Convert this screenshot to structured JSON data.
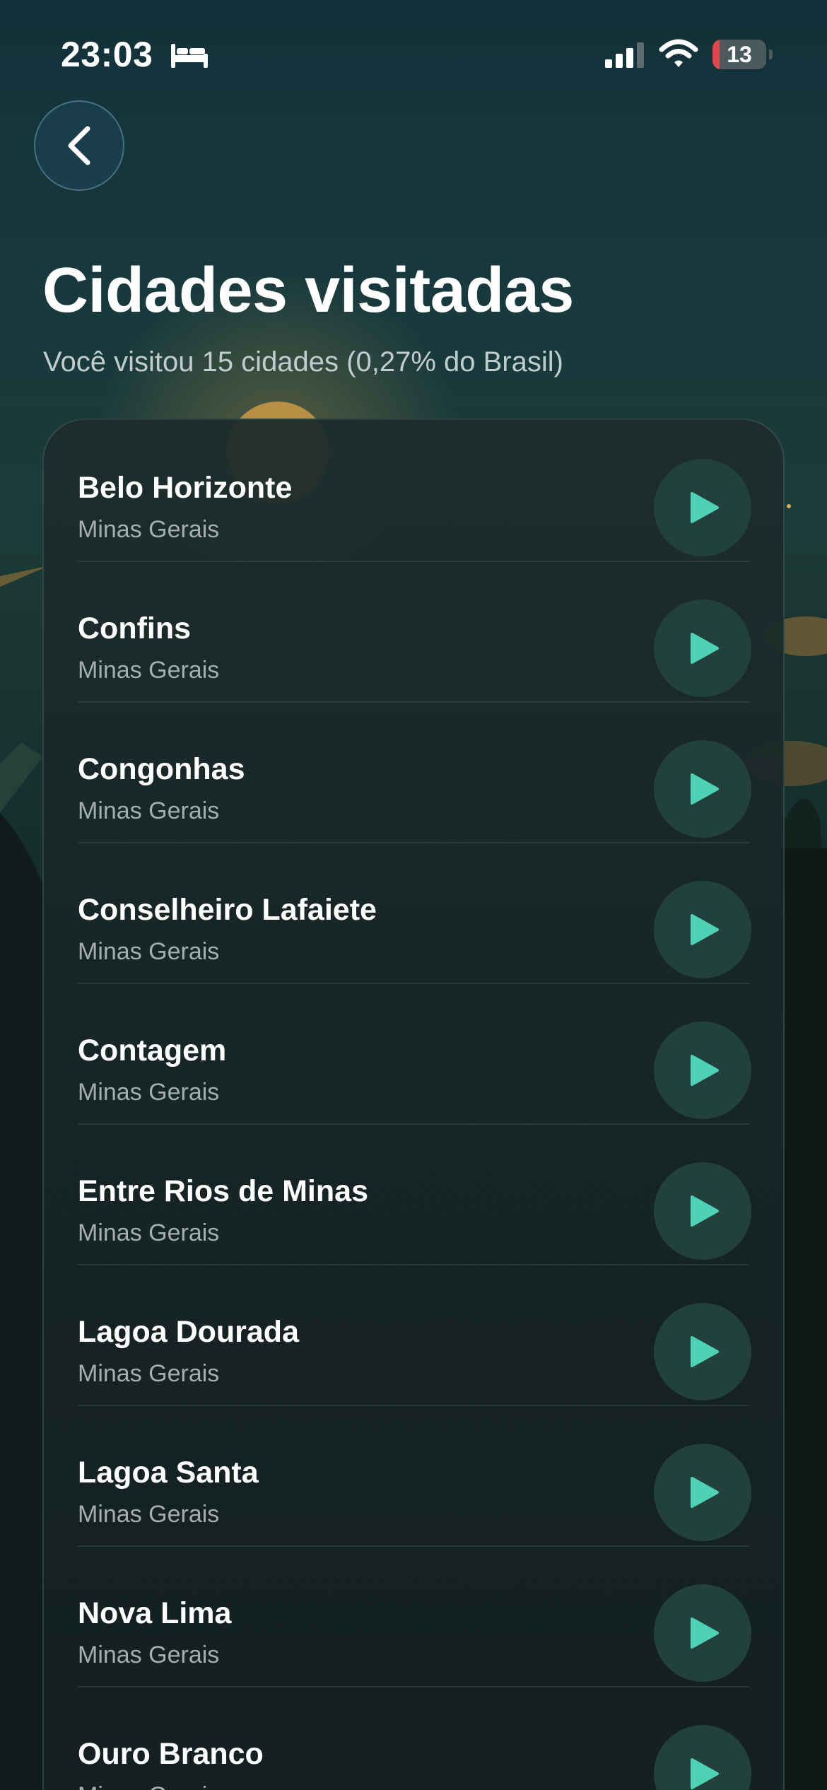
{
  "status_bar": {
    "time": "23:03",
    "battery_level": "13",
    "battery_fraction": 0.13,
    "icons": [
      "bed-icon",
      "cellular-signal-icon",
      "wifi-icon",
      "battery-icon"
    ]
  },
  "header": {
    "back_icon": "chevron-left-icon",
    "title": "Cidades visitadas",
    "subtitle": "Você visitou 15 cidades (0,27% do Brasil)"
  },
  "colors": {
    "accent": "#4fd1b5",
    "play_button_bg": "#22413c",
    "battery_low": "#e0464d",
    "card_bg": "#1a2a2a"
  },
  "cities": [
    {
      "name": "Belo Horizonte",
      "state": "Minas Gerais",
      "icon": "play-icon"
    },
    {
      "name": "Confins",
      "state": "Minas Gerais",
      "icon": "play-icon"
    },
    {
      "name": "Congonhas",
      "state": "Minas Gerais",
      "icon": "play-icon"
    },
    {
      "name": "Conselheiro Lafaiete",
      "state": "Minas Gerais",
      "icon": "play-icon"
    },
    {
      "name": "Contagem",
      "state": "Minas Gerais",
      "icon": "play-icon"
    },
    {
      "name": "Entre Rios de Minas",
      "state": "Minas Gerais",
      "icon": "play-icon"
    },
    {
      "name": "Lagoa Dourada",
      "state": "Minas Gerais",
      "icon": "play-icon"
    },
    {
      "name": "Lagoa Santa",
      "state": "Minas Gerais",
      "icon": "play-icon"
    },
    {
      "name": "Nova Lima",
      "state": "Minas Gerais",
      "icon": "play-icon"
    },
    {
      "name": "Ouro Branco",
      "state": "Minas Gerais",
      "icon": "play-icon"
    }
  ]
}
